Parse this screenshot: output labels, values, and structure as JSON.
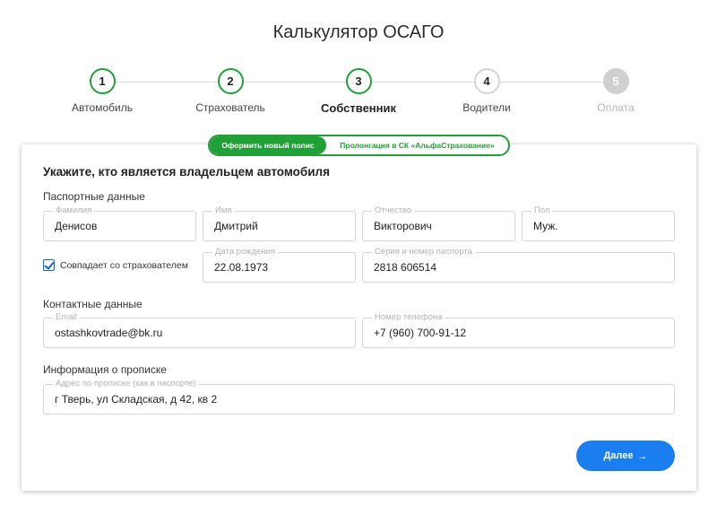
{
  "page": {
    "title": "Калькулятор ОСАГО"
  },
  "stepper": {
    "steps": [
      {
        "number": "1",
        "label": "Автомобиль"
      },
      {
        "number": "2",
        "label": "Страхователь"
      },
      {
        "number": "3",
        "label": "Собственник"
      },
      {
        "number": "4",
        "label": "Водители"
      },
      {
        "number": "5",
        "label": "Оплата"
      }
    ],
    "active_step": 3
  },
  "toggle": {
    "new_policy": "Оформить новый полис",
    "prolong": "Пролонгация в СК «АльфаСтрахование»"
  },
  "form": {
    "heading": "Укажите, кто является владельцем автомобиля",
    "passport": {
      "title": "Паспортные данные",
      "surname": {
        "label": "Фамилия",
        "value": "Денисов"
      },
      "name": {
        "label": "Имя",
        "value": "Дмитрий"
      },
      "patronymic": {
        "label": "Отчество",
        "value": "Викторович"
      },
      "sex": {
        "label": "Пол",
        "value": "Муж."
      },
      "same_as_insurer": {
        "label": "Совпадает со страхователем",
        "checked": true
      },
      "birth_date": {
        "label": "Дата рождения",
        "value": "22.08.1973"
      },
      "passport_number": {
        "label": "Серия и номер паспорта",
        "value": "2818 606514"
      }
    },
    "contacts": {
      "title": "Контактные данные",
      "email": {
        "label": "Email",
        "value": "ostashkovtrade@bk.ru"
      },
      "phone": {
        "label": "Номер телефона",
        "value": "+7 (960) 700-91-12"
      }
    },
    "registration": {
      "title": "Информация о прописке",
      "address": {
        "label": "Адрес по прописке (как в паспорте)",
        "value": "г Тверь, ул Складская, д 42, кв 2"
      }
    },
    "next_button": {
      "label": "Далее",
      "arrow": "→"
    }
  },
  "colors": {
    "accent_green": "#21a038",
    "button_blue": "#1a7ef0"
  }
}
